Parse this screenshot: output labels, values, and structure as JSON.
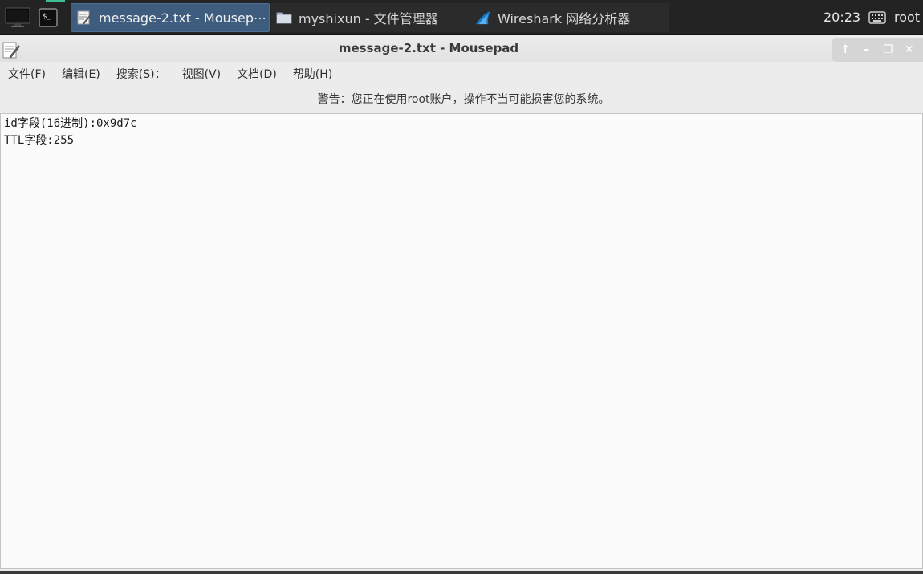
{
  "taskbar": {
    "tasks": [
      {
        "label": "message-2.txt - Mousep⋯",
        "icon": "text-editor-icon",
        "active": true
      },
      {
        "label": "myshixun - 文件管理器",
        "icon": "folder-icon",
        "active": false
      },
      {
        "label": "Wireshark 网络分析器",
        "icon": "wireshark-fin-icon",
        "active": false
      }
    ],
    "clock": "20:23",
    "user": "root"
  },
  "window": {
    "title": "message-2.txt - Mousepad",
    "controls": [
      "↑",
      "–",
      "❐",
      "✕"
    ]
  },
  "menu": {
    "items": [
      "文件(F)",
      "编辑(E)",
      "搜索(S)：",
      "视图(V)",
      "文档(D)",
      "帮助(H)"
    ]
  },
  "warning": "警告：您正在使用root账户，操作不当可能损害您的系统。",
  "editor": {
    "lines": [
      "id字段(16进制):0x9d7c",
      "TTL字段:255"
    ]
  },
  "colors": {
    "taskbar_bg": "#232323",
    "active_task": "#3d5c7e",
    "accent_green": "#3fbf8f",
    "wireshark_blue": "#1679c7"
  }
}
